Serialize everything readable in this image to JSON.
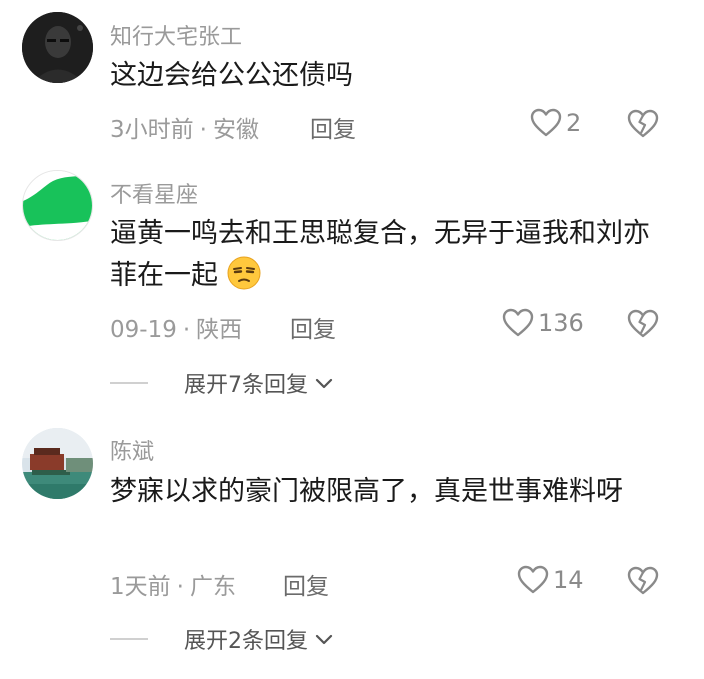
{
  "comments": [
    {
      "author": "知行大宅张工",
      "text": "这边会给公公还债吗",
      "time": "3小时前",
      "location": "安徽",
      "reply_label": "回复",
      "likes": "2",
      "avatar": "dark-portrait"
    },
    {
      "author": "不看星座",
      "text": "逼黄一鸣去和王思聪复合，无异于逼我和刘亦菲在一起",
      "time": "09-19",
      "location": "陕西",
      "reply_label": "回复",
      "likes": "136",
      "expand_label": "展开7条回复",
      "avatar": "green-shape",
      "emoji": "unamused-face-emoji"
    },
    {
      "author": "陈斌",
      "text": "梦寐以求的豪门被限高了，真是世事难料呀",
      "time": "1天前",
      "location": "广东",
      "reply_label": "回复",
      "likes": "14",
      "expand_label": "展开2条回复",
      "avatar": "lake-boat-photo"
    }
  ],
  "meta_separator": "·",
  "icons": {
    "like": "heart-outline-icon",
    "dislike": "broken-heart-icon",
    "expand": "chevron-down-icon"
  },
  "colors": {
    "secondary_text": "#9a9a9a",
    "primary_text": "#1a1a1a",
    "avatar_green": "#18c25a"
  }
}
